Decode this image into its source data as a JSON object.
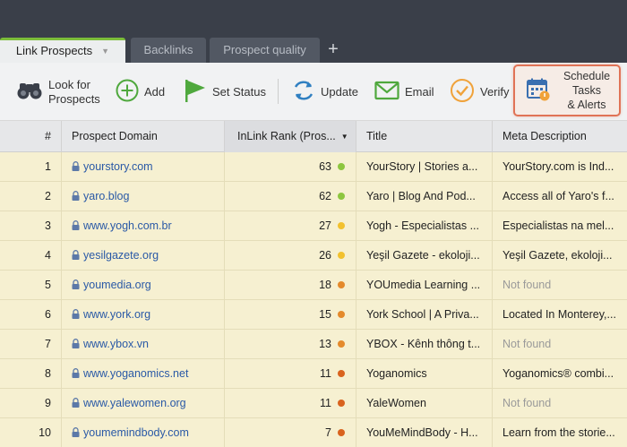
{
  "tabs": [
    {
      "label": "Link Prospects",
      "active": true
    },
    {
      "label": "Backlinks",
      "active": false
    },
    {
      "label": "Prospect quality",
      "active": false
    }
  ],
  "toolbar": {
    "look_for_prospects": "Look for\nProspects",
    "add": "Add",
    "set_status": "Set Status",
    "update": "Update",
    "email": "Email",
    "verify": "Verify",
    "schedule": "Schedule\nTasks\n& Alerts"
  },
  "columns": {
    "num": "#",
    "domain": "Prospect Domain",
    "rank": "InLink Rank (Pros...",
    "title": "Title",
    "meta": "Meta Description"
  },
  "colors": {
    "green": "#8dc63f",
    "yellow": "#f2c12e",
    "orange": "#e48a2c",
    "deep_orange": "#d9631e",
    "accent": "#e07356"
  },
  "rows": [
    {
      "num": "1",
      "domain": "yourstory.com",
      "rank": "63",
      "dot": "green",
      "title": "YourStory | Stories a...",
      "meta": "YourStory.com is Ind...",
      "meta_nf": false
    },
    {
      "num": "2",
      "domain": "yaro.blog",
      "rank": "62",
      "dot": "green",
      "title": "Yaro | Blog And Pod...",
      "meta": "Access all of Yaro's f...",
      "meta_nf": false
    },
    {
      "num": "3",
      "domain": "www.yogh.com.br",
      "rank": "27",
      "dot": "yellow",
      "title": "Yogh - Especialistas ...",
      "meta": "Especialistas na mel...",
      "meta_nf": false
    },
    {
      "num": "4",
      "domain": "yesilgazete.org",
      "rank": "26",
      "dot": "yellow",
      "title": "Yeşil Gazete - ekoloji...",
      "meta": "Yeşil Gazete, ekoloji...",
      "meta_nf": false
    },
    {
      "num": "5",
      "domain": "youmedia.org",
      "rank": "18",
      "dot": "orange",
      "title": "YOUmedia Learning ...",
      "meta": "Not found",
      "meta_nf": true
    },
    {
      "num": "6",
      "domain": "www.york.org",
      "rank": "15",
      "dot": "orange",
      "title": "York School | A Priva...",
      "meta": "Located In Monterey,...",
      "meta_nf": false
    },
    {
      "num": "7",
      "domain": "www.ybox.vn",
      "rank": "13",
      "dot": "orange",
      "title": "YBOX - Kênh thông t...",
      "meta": "Not found",
      "meta_nf": true
    },
    {
      "num": "8",
      "domain": "www.yoganomics.net",
      "rank": "11",
      "dot": "deep_orange",
      "title": "Yoganomics",
      "meta": "Yoganomics® combi...",
      "meta_nf": false
    },
    {
      "num": "9",
      "domain": "www.yalewomen.org",
      "rank": "11",
      "dot": "deep_orange",
      "title": "YaleWomen",
      "meta": "Not found",
      "meta_nf": true
    },
    {
      "num": "10",
      "domain": "youmemindbody.com",
      "rank": "7",
      "dot": "deep_orange",
      "title": "YouMeMindBody - H...",
      "meta": "Learn from the storie...",
      "meta_nf": false
    }
  ]
}
